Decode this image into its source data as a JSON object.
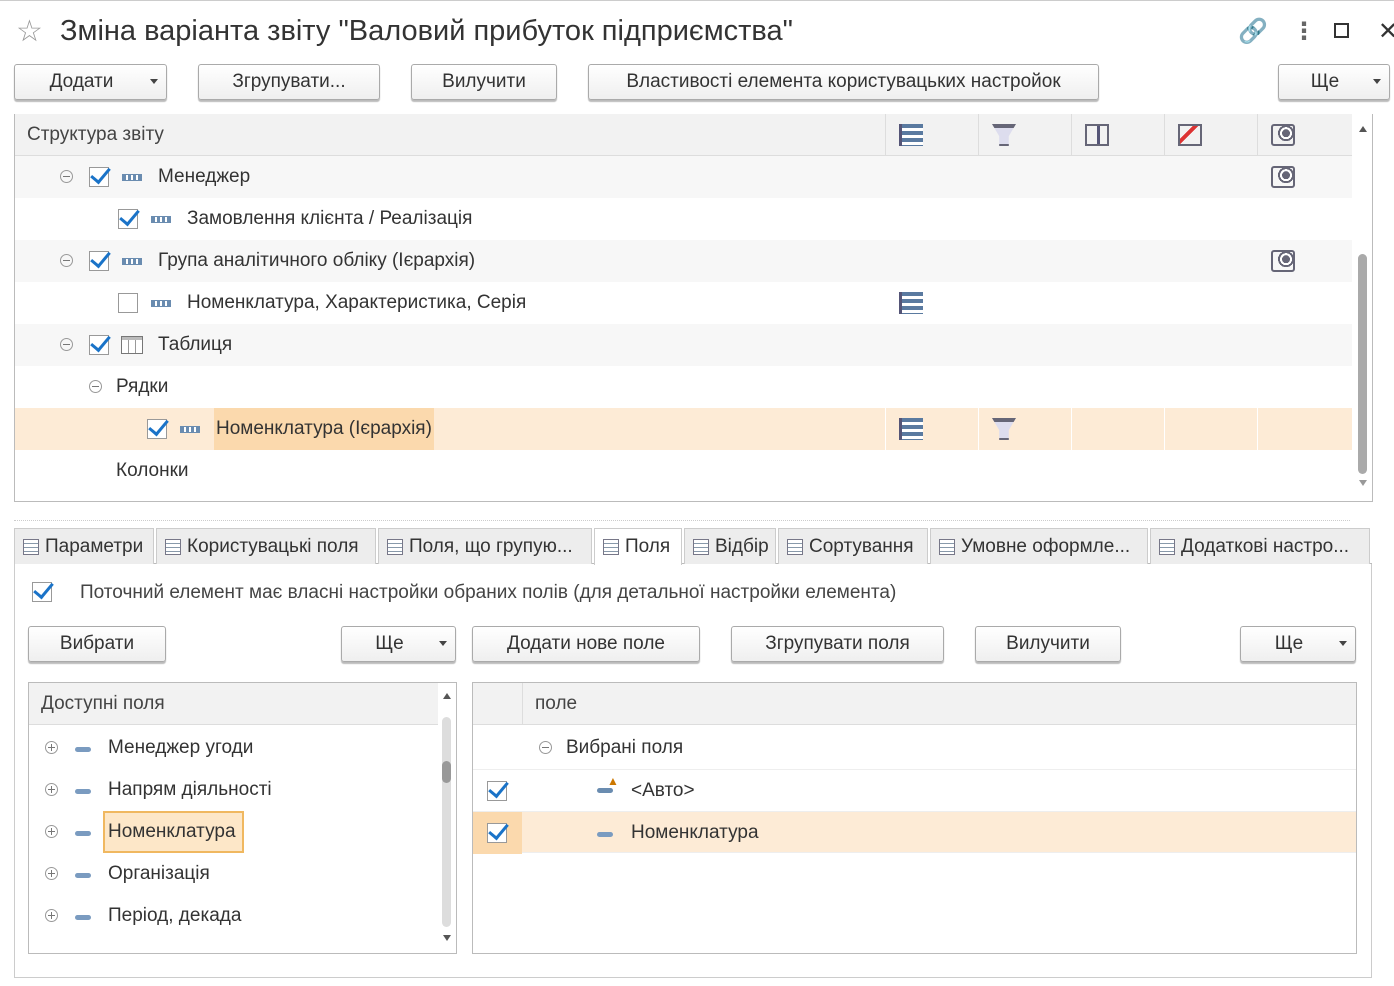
{
  "window": {
    "title": "Зміна варіанта звіту \"Валовий прибуток підприємства\""
  },
  "toolbar": {
    "add": "Додати",
    "group": "Згрупувати...",
    "remove": "Вилучити",
    "properties": "Властивості елемента користувацьких настройок",
    "more": "Ще"
  },
  "structure": {
    "header": "Структура звіту",
    "rows": [
      {
        "label": "Менеджер",
        "checked": true,
        "icon": "grouping-icon"
      },
      {
        "label": "Замовлення клієнта / Реалізація",
        "checked": true,
        "icon": "grouping-icon"
      },
      {
        "label": "Група аналітичного обліку (Ієрархія)",
        "checked": true,
        "icon": "grouping-icon"
      },
      {
        "label": "Номенклатура, Характеристика, Серія",
        "checked": false,
        "icon": "grouping-icon"
      },
      {
        "label": "Таблиця",
        "checked": true,
        "icon": "table-icon"
      },
      {
        "label": "Рядки"
      },
      {
        "label": "Номенклатура (Ієрархія)",
        "checked": true,
        "icon": "grouping-icon",
        "selected": true
      },
      {
        "label": "Колонки"
      }
    ]
  },
  "tabs": [
    {
      "label": "Параметри"
    },
    {
      "label": "Користувацькі поля"
    },
    {
      "label": "Поля, що групую..."
    },
    {
      "label": "Поля",
      "active": true
    },
    {
      "label": "Відбір"
    },
    {
      "label": "Сортування"
    },
    {
      "label": "Умовне оформле..."
    },
    {
      "label": "Додаткові настро..."
    }
  ],
  "fields_tab": {
    "own_settings_label": "Поточний елемент має власні настройки обраних полів (для детальної настройки елемента)",
    "own_settings_checked": true,
    "select_button": "Вибрати",
    "more_left": "Ще",
    "add_new_field": "Додати нове поле",
    "group_fields": "Згрупувати поля",
    "remove": "Вилучити",
    "more_right": "Ще",
    "available_header": "Доступні поля",
    "available": [
      "Менеджер угоди",
      "Напрям діяльності",
      "Номенклатура",
      "Організація",
      "Період, декада"
    ],
    "selected_header": "поле",
    "selected_group": "Вибрані поля",
    "selected": [
      {
        "label": "<Авто>",
        "checked": true
      },
      {
        "label": "Номенклатура",
        "checked": true
      }
    ]
  }
}
